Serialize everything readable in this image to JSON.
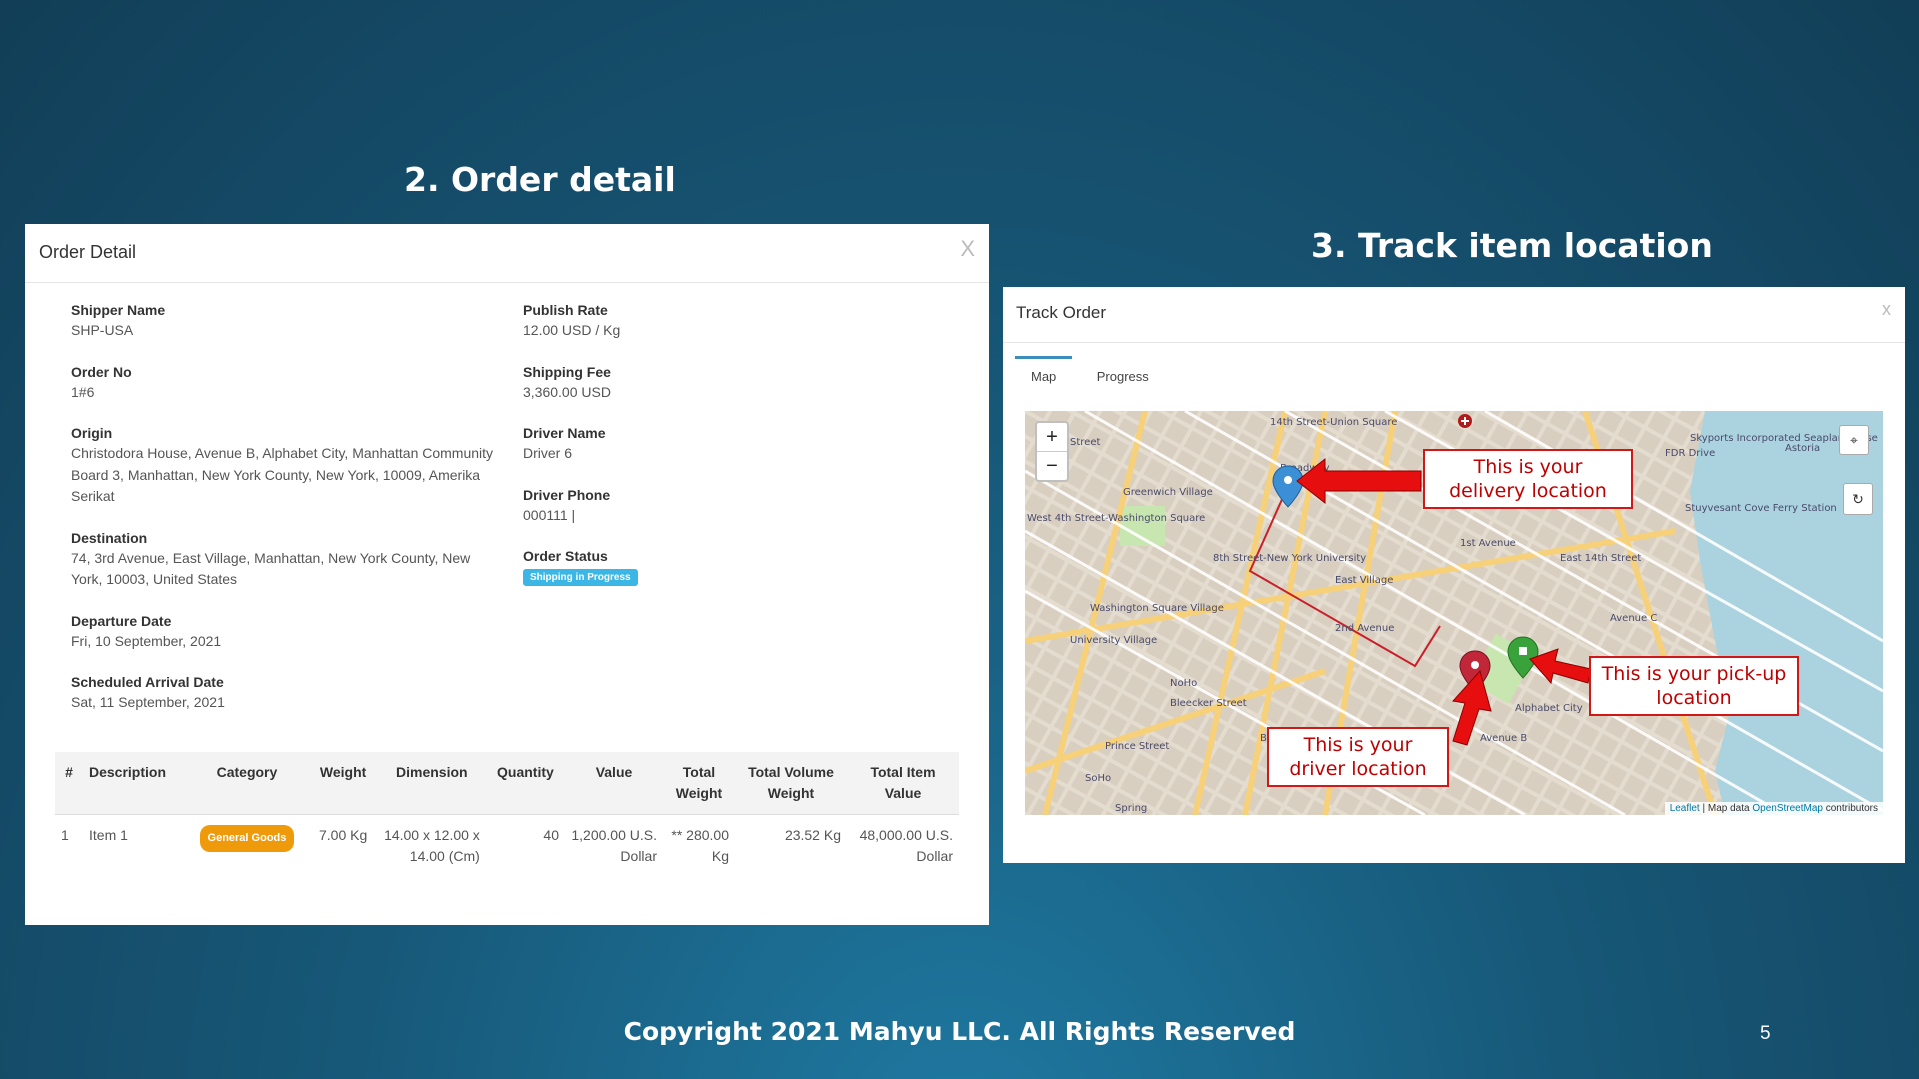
{
  "headings": {
    "order_detail": "2. Order detail",
    "track_location": "3. Track item location"
  },
  "order_panel": {
    "title": "Order Detail",
    "close": "X",
    "left_fields": [
      {
        "label": "Shipper Name",
        "value": "SHP-USA"
      },
      {
        "label": "Order No",
        "value": "1#6"
      },
      {
        "label": "Origin",
        "value": "Christodora House, Avenue B, Alphabet City, Manhattan Community Board 3, Manhattan, New York County, New York, 10009, Amerika Serikat"
      },
      {
        "label": "Destination",
        "value": "74, 3rd Avenue, East Village, Manhattan, New York County, New York, 10003, United States"
      },
      {
        "label": "Departure Date",
        "value": "Fri, 10 September, 2021"
      },
      {
        "label": "Scheduled Arrival Date",
        "value": "Sat, 11 September, 2021"
      }
    ],
    "right_fields": [
      {
        "label": "Publish Rate",
        "value": "12.00 USD / Kg"
      },
      {
        "label": "Shipping Fee",
        "value": "3,360.00 USD"
      },
      {
        "label": "Driver Name",
        "value": "Driver 6"
      },
      {
        "label": "Driver Phone",
        "value": "000111 |"
      },
      {
        "label": "Order Status",
        "value": "Shipping in Progress"
      }
    ],
    "table": {
      "headers": [
        "#",
        "Description",
        "Category",
        "Weight",
        "Dimension",
        "Quantity",
        "Value",
        "Total Weight",
        "Total Volume Weight",
        "Total Item Value"
      ],
      "rows": [
        [
          "1",
          "Item 1",
          "General Goods",
          "7.00 Kg",
          "14.00 x 12.00 x 14.00 (Cm)",
          "40",
          "1,200.00 U.S. Dollar",
          "** 280.00 Kg",
          "23.52 Kg",
          "48,000.00 U.S. Dollar"
        ]
      ]
    }
  },
  "track_panel": {
    "title": "Track Order",
    "close": "x",
    "tabs": [
      "Map",
      "Progress"
    ],
    "active_tab": "Map",
    "zoom_in": "+",
    "zoom_out": "−",
    "attribution": {
      "leaflet": "Leaflet",
      "separator": " | Map data ",
      "osm": "OpenStreetMap",
      "suffix": " contributors"
    },
    "map_labels": [
      "14th Street-Union Square",
      "Greenwich Village",
      "8th Street-New York University",
      "East Village",
      "Washington Square Village",
      "University Village",
      "NoHo",
      "Bleecker Street",
      "Prince Street",
      "SoHo",
      "Spring",
      "1st Avenue",
      "Alphabet City",
      "East 14th Street",
      "Avenue C",
      "FDR Drive",
      "Broadway",
      "Bowery",
      "Avenue B",
      "2nd Avenue",
      "West 4th Street-Washington Square",
      "Stuyvesant Cove Ferry Station",
      "Skyports Incorporated Seaplane Base",
      "Astoria",
      "Street"
    ],
    "callouts": {
      "delivery": "This is your delivery location",
      "pickup": "This is your pick-up location",
      "driver": "This is your driver location"
    },
    "marker_colors": {
      "delivery": "#3b8fd4",
      "pickup": "#3aa23a",
      "driver": "#c0283a"
    }
  },
  "footer": {
    "copyright": "Copyright 2021 Mahyu LLC. All Rights Reserved",
    "page_number": "5"
  }
}
